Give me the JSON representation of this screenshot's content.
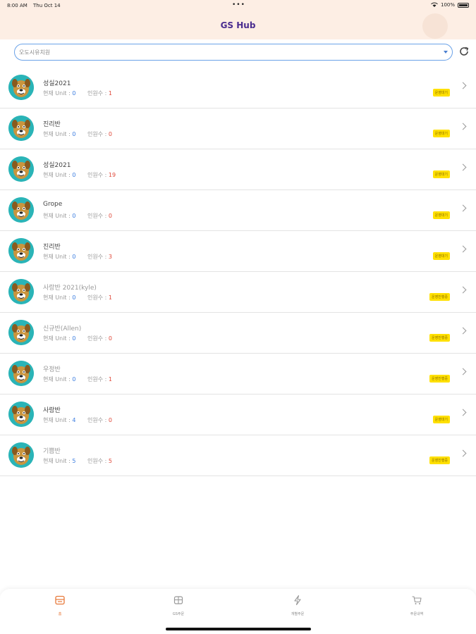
{
  "status_bar": {
    "time": "8:00 AM",
    "date": "Thu Oct 14",
    "dots": "•••",
    "battery": "100%"
  },
  "header": {
    "title": "GS Hub"
  },
  "filter": {
    "selected": "오도시유치원"
  },
  "rows": [
    {
      "title": "성실2021",
      "unit_label": "현재 Unit :",
      "unit": "0",
      "member_label": "인원수 :",
      "members": "1",
      "badge": "운영대기",
      "dim": false
    },
    {
      "title": "진리반",
      "unit_label": "현재 Unit :",
      "unit": "0",
      "member_label": "인원수 :",
      "members": "0",
      "badge": "운영대기",
      "dim": false
    },
    {
      "title": "성실2021",
      "unit_label": "현재 Unit :",
      "unit": "0",
      "member_label": "인원수 :",
      "members": "19",
      "badge": "운영대기",
      "dim": false
    },
    {
      "title": "Grope",
      "unit_label": "현재 Unit :",
      "unit": "0",
      "member_label": "인원수 :",
      "members": "0",
      "badge": "운영대기",
      "dim": false
    },
    {
      "title": "진리반",
      "unit_label": "현재 Unit :",
      "unit": "0",
      "member_label": "인원수 :",
      "members": "3",
      "badge": "운영대기",
      "dim": false
    },
    {
      "title": "사랑반 2021(kyle)",
      "unit_label": "현재 Unit :",
      "unit": "0",
      "member_label": "인원수 :",
      "members": "1",
      "badge": "운영진행중",
      "dim": true
    },
    {
      "title": "신규반(Allen)",
      "unit_label": "현재 Unit :",
      "unit": "0",
      "member_label": "인원수 :",
      "members": "0",
      "badge": "운영진행중",
      "dim": true
    },
    {
      "title": "우정반",
      "unit_label": "현재 Unit :",
      "unit": "0",
      "member_label": "인원수 :",
      "members": "1",
      "badge": "운영진행중",
      "dim": true
    },
    {
      "title": "사랑반",
      "unit_label": "현재 Unit :",
      "unit": "4",
      "member_label": "인원수 :",
      "members": "0",
      "badge": "운영대기",
      "dim": false
    },
    {
      "title": "기쁨반",
      "unit_label": "현재 Unit :",
      "unit": "5",
      "member_label": "인원수 :",
      "members": "5",
      "badge": "운영진행중",
      "dim": true
    }
  ],
  "tabs": [
    {
      "label": "홈",
      "icon": "home-icon",
      "active": true
    },
    {
      "label": "GS주문",
      "icon": "box-icon",
      "active": false
    },
    {
      "label": "개별주문",
      "icon": "lightning-icon",
      "active": false
    },
    {
      "label": "주문내역",
      "icon": "cart-icon",
      "active": false
    }
  ],
  "colors": {
    "header_bg": "#fdeee4",
    "title": "#4a2c8f",
    "badge": "#ffe000",
    "accent": "#e7793a",
    "unit": "#3b7de0",
    "members": "#e04a3b"
  }
}
